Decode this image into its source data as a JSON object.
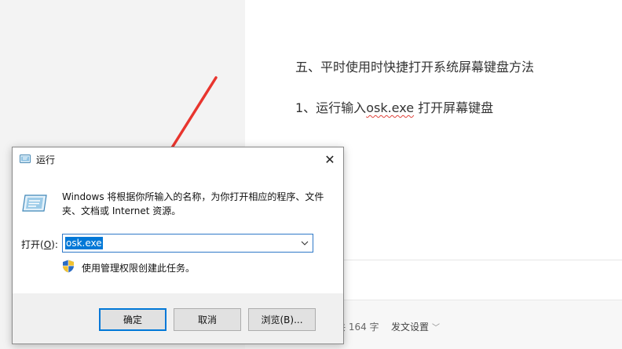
{
  "document": {
    "heading": "五、平时使用时快捷打开系统屏幕键盘方法",
    "step_prefix": "1、运行输入",
    "step_command": "osk.exe",
    "step_suffix": " 打开屏幕键盘",
    "status_word_count": "共 164 字",
    "status_publish_settings": "发文设置"
  },
  "dialog": {
    "title": "运行",
    "close_glyph": "✕",
    "description": "Windows 将根据你所输入的名称，为你打开相应的程序、文件夹、文档或 Internet 资源。",
    "open_label_prefix": "打开(",
    "open_label_key": "O",
    "open_label_suffix": "):",
    "input_value": "osk.exe",
    "admin_note": "使用管理权限创建此任务。",
    "buttons": {
      "ok": "确定",
      "cancel": "取消",
      "browse": "浏览(B)..."
    }
  },
  "icons": {
    "title": "run-icon",
    "big": "run-icon",
    "admin": "uac-shield-icon",
    "dropdown": "chevron-down-icon",
    "publish": "chevron-down-icon"
  },
  "colors": {
    "selection": "#0078d7",
    "annotation_arrow": "#e8352e",
    "input_border": "#2f79c8"
  }
}
